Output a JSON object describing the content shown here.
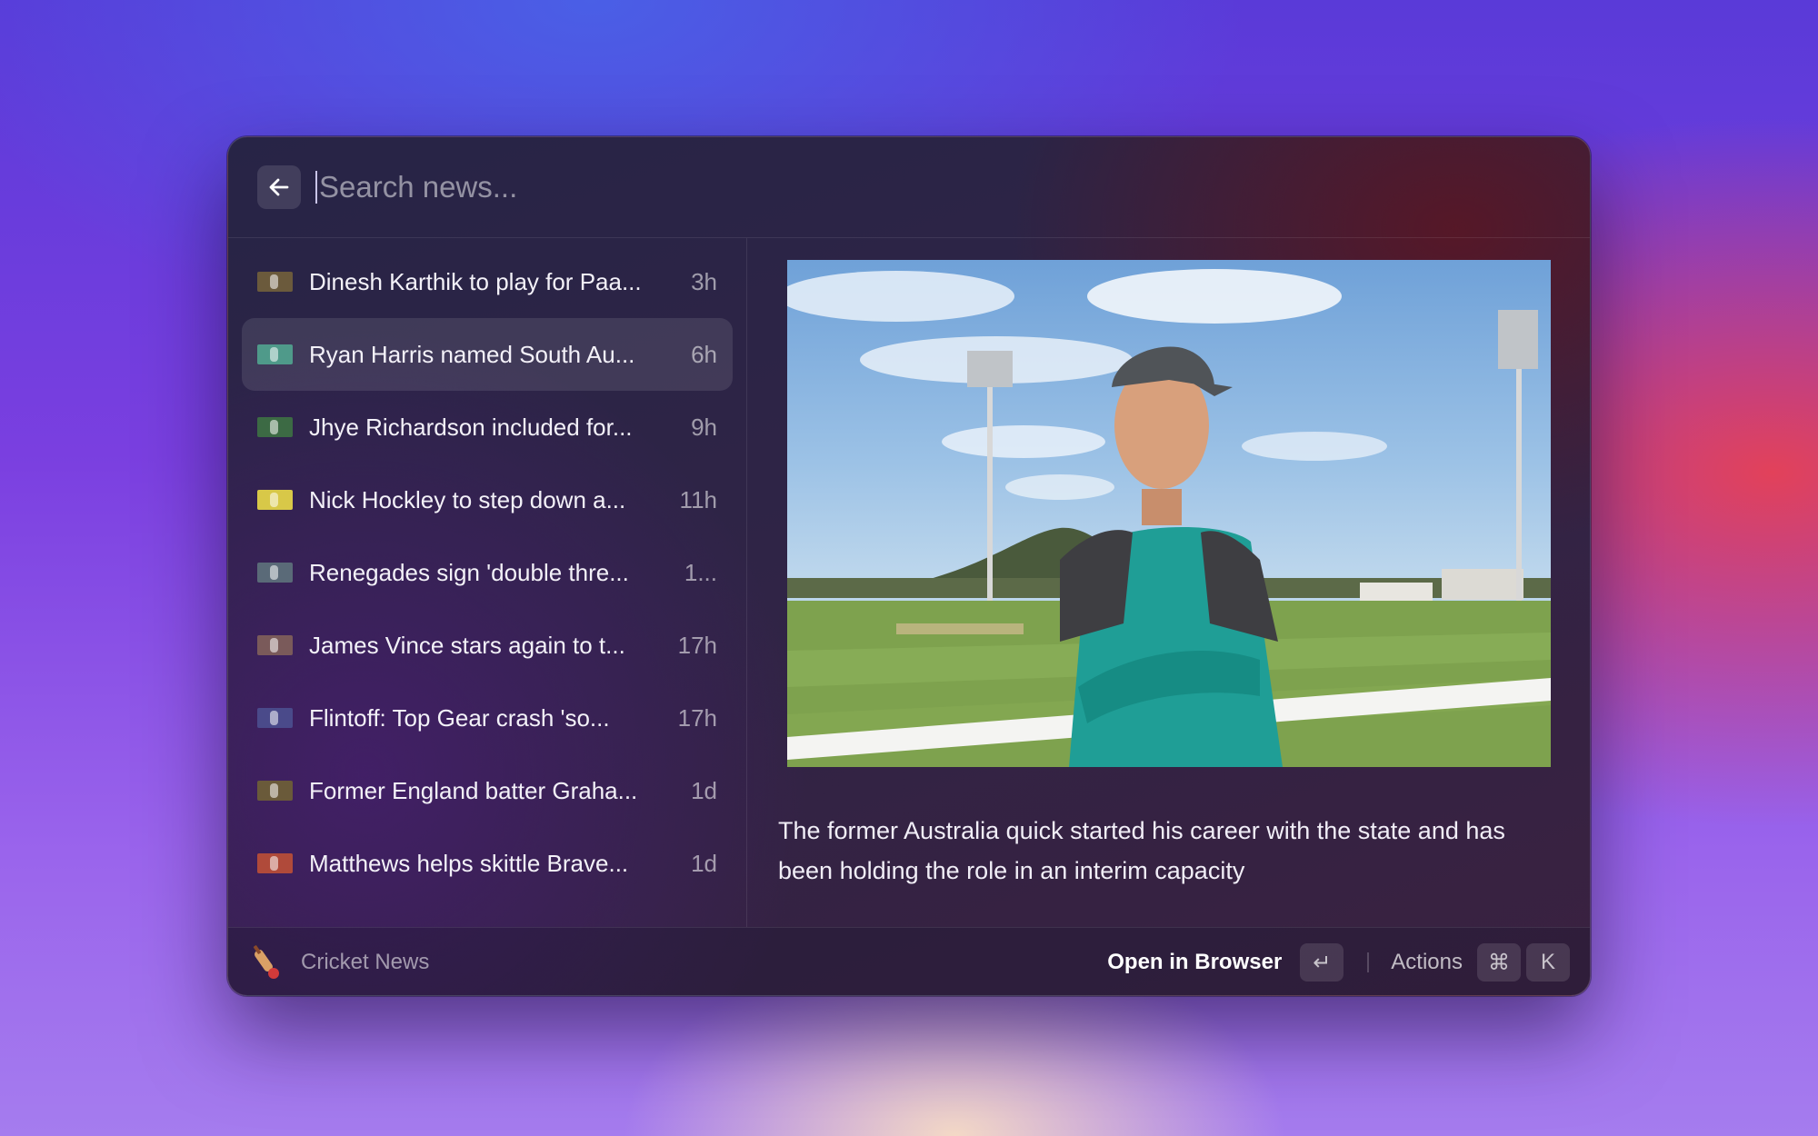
{
  "search": {
    "placeholder": "Search news..."
  },
  "news_items": [
    {
      "title": "Dinesh Karthik to play for Paa...",
      "time": "3h",
      "thumb_color": "#6b5a3c"
    },
    {
      "title": "Ryan Harris named South Au...",
      "time": "6h",
      "thumb_color": "#4f9a8a",
      "selected": true
    },
    {
      "title": "Jhye Richardson included for...",
      "time": "9h",
      "thumb_color": "#3c6a44"
    },
    {
      "title": "Nick Hockley to step down a...",
      "time": "11h",
      "thumb_color": "#d8c848"
    },
    {
      "title": "Renegades sign 'double thre...",
      "time": "1...",
      "thumb_color": "#5a6a78"
    },
    {
      "title": "James Vince stars again to t...",
      "time": "17h",
      "thumb_color": "#7a5a5a"
    },
    {
      "title": "Flintoff: Top Gear crash 'so...",
      "time": "17h",
      "thumb_color": "#4a4a8a"
    },
    {
      "title": "Former England batter Graha...",
      "time": "1d",
      "thumb_color": "#6a5a3a"
    },
    {
      "title": "Matthews helps skittle Brave...",
      "time": "1d",
      "thumb_color": "#b04a3a"
    }
  ],
  "detail": {
    "summary": "The former Australia quick started his career with the state and has been holding the role in an interim capacity"
  },
  "footer": {
    "extension_name": "Cricket News",
    "primary_action": "Open in Browser",
    "primary_key": "↵",
    "secondary_action": "Actions",
    "secondary_keys": [
      "⌘",
      "K"
    ]
  }
}
